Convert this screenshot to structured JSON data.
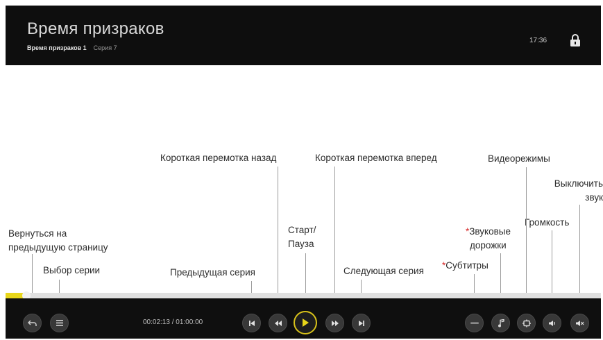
{
  "header": {
    "title": "Время призраков",
    "subtitle": "Время призраков 1",
    "episode": "Серия 7",
    "clock": "17:36"
  },
  "player": {
    "timecode": "00:02:13 / 01:00:00",
    "progress_fraction": 0.035
  },
  "annotations": {
    "back": [
      "Вернуться на",
      "предыдущую страницу"
    ],
    "episode_select": "Выбор серии",
    "prev_episode": "Предыдущая серия",
    "rewind": "Короткая перемотка назад",
    "play_pause": [
      "Старт/",
      "Пауза"
    ],
    "forward": "Короткая перемотка вперед",
    "next_episode": "Следующая серия",
    "subtitles_star": "*",
    "subtitles": "Субтитры",
    "audio_star": "*",
    "audio": [
      "Звуковые",
      "дорожки"
    ],
    "video_modes": "Видеорежимы",
    "volume": "Громкость",
    "mute": [
      "Выключить",
      "звук"
    ]
  },
  "colors": {
    "accent": "#e8d61a",
    "asterisk": "#d62a2a",
    "bar_background": "#0f0f0f"
  },
  "icons": {
    "back": "back-icon",
    "episode_list": "list-icon",
    "prev": "skip-previous-icon",
    "rewind": "rewind-icon",
    "play": "play-icon",
    "forward": "fast-forward-icon",
    "next": "skip-next-icon",
    "subtitles": "subtitles-icon",
    "audio": "music-note-icon",
    "video_mode": "video-mode-icon",
    "volume": "volume-icon",
    "mute": "mute-icon",
    "lock": "lock-icon"
  }
}
